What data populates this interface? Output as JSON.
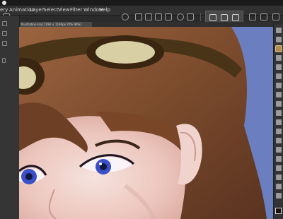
{
  "menubar": {
    "items": [
      "ery",
      "Animation",
      "Layer",
      "Select",
      "View",
      "Filter",
      "Window",
      "Help"
    ]
  },
  "document": {
    "tab_title": "Illustration.kra [1190 × 1190px 70% 96%]"
  },
  "canvas": {
    "background_color": "#6b7fc0",
    "hair_color": "#7a4a2c",
    "skin_color": "#f1d2cb",
    "eye_color": "#3b4fc8",
    "goggle_strap_color": "#4a3418",
    "goggle_lens_color": "#d8cfa5"
  },
  "toolbox": {
    "active_tool": "brush-tool",
    "foreground_color": "#1a0f0b"
  }
}
